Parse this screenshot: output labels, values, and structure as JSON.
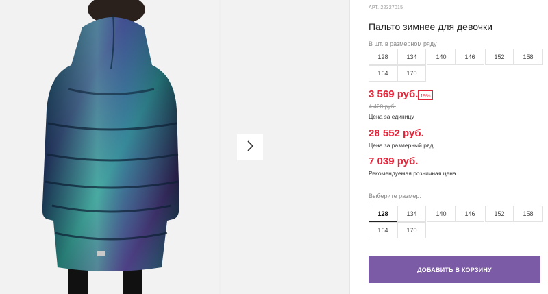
{
  "product": {
    "article": "АРТ. 22327015",
    "title": "Пальто зимнее для девочки"
  },
  "size_range": {
    "label": "В шт. в размерном ряду",
    "sizes": [
      "128",
      "134",
      "140",
      "146",
      "152",
      "158",
      "164",
      "170"
    ]
  },
  "pricing": {
    "unit_price": "3 569 руб.",
    "discount_badge": "19%",
    "old_price": "4 420 руб.",
    "unit_label": "Цена за единицу",
    "range_price": "28 552 руб.",
    "range_label": "Цена за размерный ряд",
    "retail_price": "7 039 руб.",
    "retail_label": "Рекомендуемая розничная цена"
  },
  "size_select": {
    "label": "Выберите размер:",
    "sizes": [
      "128",
      "134",
      "140",
      "146",
      "152",
      "158",
      "164",
      "170"
    ],
    "selected": "128"
  },
  "cart": {
    "add_label": "ДОБАВИТЬ В КОРЗИНУ"
  },
  "gallery": {
    "next_icon": "chevron-right-icon"
  },
  "colors": {
    "price_red": "#e3263b",
    "button_purple": "#7b5aa6"
  }
}
